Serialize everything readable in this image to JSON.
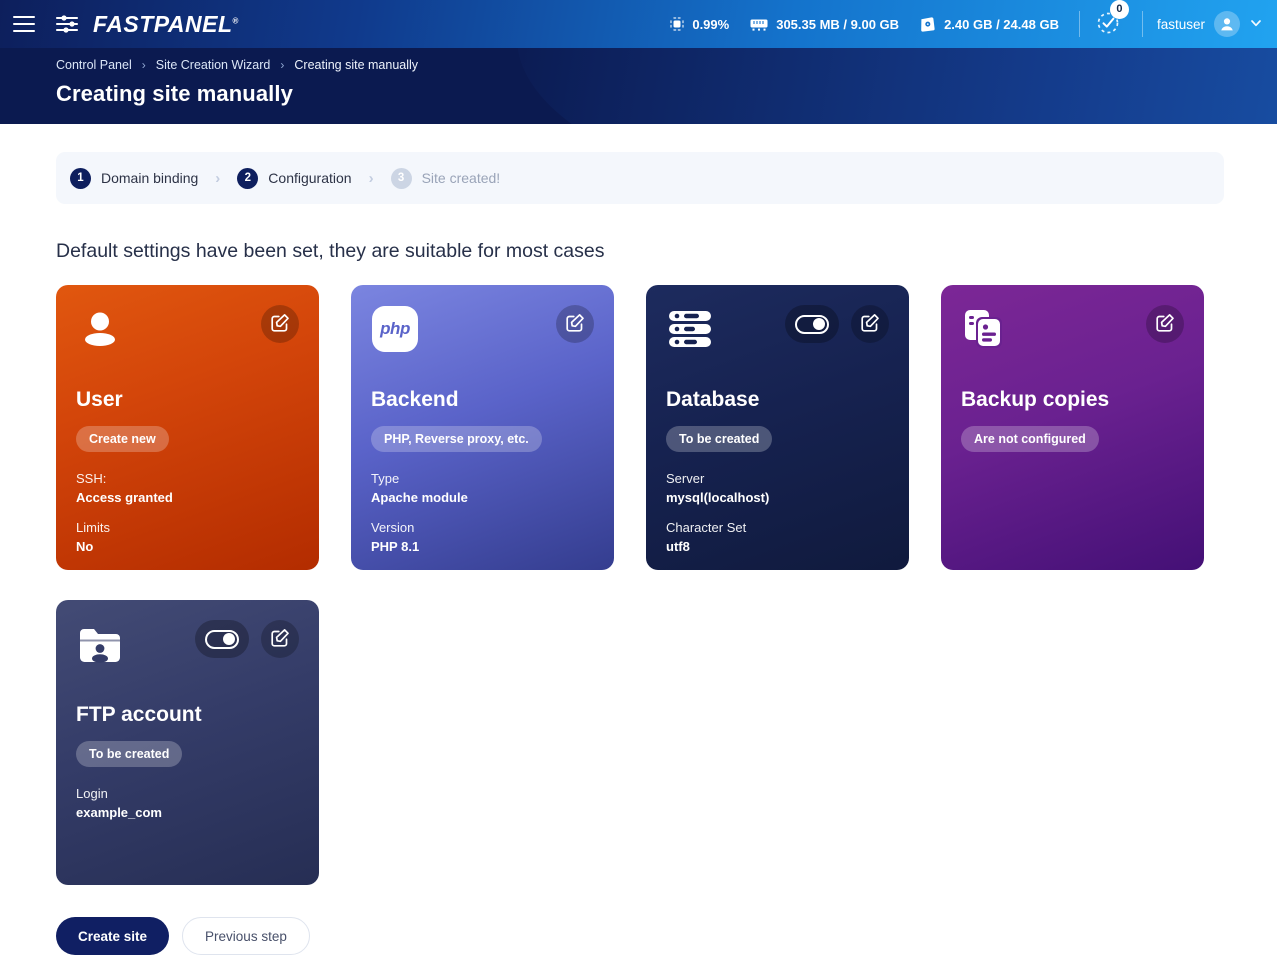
{
  "topbar": {
    "menu_icon": "hamburger-menu-icon",
    "logo_text": "FASTPANEL",
    "logo_trademark": "®",
    "stats": [
      {
        "icon": "cpu-icon",
        "label": "0.99%"
      },
      {
        "icon": "ram-icon",
        "label": "305.35 MB / 9.00 GB"
      },
      {
        "icon": "disk-icon",
        "label": "2.40 GB / 24.48 GB"
      }
    ],
    "tasks": {
      "icon": "tasks-check-icon",
      "count": "0"
    },
    "user": {
      "name": "fastuser",
      "avatar_icon": "user-avatar-icon",
      "chevron_icon": "chevron-down-icon"
    }
  },
  "header": {
    "breadcrumb": [
      {
        "label": "Control Panel"
      },
      {
        "label": "Site Creation Wizard"
      },
      {
        "label": "Creating site manually"
      }
    ],
    "breadcrumb_separator": "›",
    "title": "Creating site manually"
  },
  "stepper": {
    "separator": "›",
    "steps": [
      {
        "num": "1",
        "label": "Domain binding",
        "state": "active"
      },
      {
        "num": "2",
        "label": "Configuration",
        "state": "active"
      },
      {
        "num": "3",
        "label": "Site created!",
        "state": "inactive"
      }
    ]
  },
  "main": {
    "section_title": "Default settings have been set, they are suitable for most cases",
    "cards": [
      {
        "id": "user",
        "icon": "person-icon",
        "title": "User",
        "badge": "Create new",
        "has_toggle": false,
        "toggle_state": "off",
        "edit_icon": "edit-pencil-icon",
        "rows": [
          {
            "key": "SSH:",
            "value": "Access granted"
          },
          {
            "key": "Limits",
            "value": "No"
          }
        ]
      },
      {
        "id": "backend",
        "icon": "php-logo-icon",
        "icon_text": "php",
        "title": "Backend",
        "badge": "PHP, Reverse proxy, etc.",
        "has_toggle": false,
        "toggle_state": "off",
        "edit_icon": "edit-pencil-icon",
        "rows": [
          {
            "key": "Type",
            "value": "Apache module"
          },
          {
            "key": "Version",
            "value": "PHP 8.1"
          }
        ]
      },
      {
        "id": "database",
        "icon": "database-server-icon",
        "title": "Database",
        "badge": "To be created",
        "has_toggle": true,
        "toggle_state": "on",
        "edit_icon": "edit-pencil-icon",
        "rows": [
          {
            "key": "Server",
            "value": "mysql(localhost)"
          },
          {
            "key": "Character Set",
            "value": "utf8"
          }
        ]
      },
      {
        "id": "backup",
        "icon": "backup-copies-icon",
        "title": "Backup copies",
        "badge": "Are not configured",
        "has_toggle": false,
        "toggle_state": "off",
        "edit_icon": "edit-pencil-icon",
        "rows": []
      },
      {
        "id": "ftp",
        "icon": "ftp-folder-user-icon",
        "title": "FTP account",
        "badge": "To be created",
        "has_toggle": true,
        "toggle_state": "on",
        "edit_icon": "edit-pencil-icon",
        "rows": [
          {
            "key": "Login",
            "value": "example_com"
          }
        ]
      }
    ],
    "actions": {
      "primary_label": "Create site",
      "secondary_label": "Previous step"
    }
  },
  "colors": {
    "brand_navy": "#101f63",
    "brand_blue": "#21a3f0",
    "card_user": "#d3450a",
    "card_backend": "#5a63c9",
    "card_database": "#162250",
    "card_backup": "#6a2190",
    "card_ftp": "#343c68"
  }
}
